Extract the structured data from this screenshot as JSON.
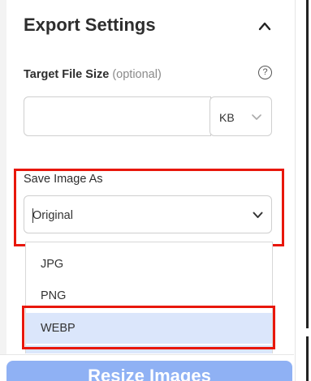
{
  "export_settings": {
    "title": "Export Settings",
    "target_file_size": {
      "label": "Target File Size",
      "optional_text": "(optional)",
      "help_glyph": "?",
      "value": "",
      "unit": "KB"
    },
    "save_image_as": {
      "label": "Save Image As",
      "selected": "Original",
      "options": [
        "JPG",
        "PNG",
        "WEBP"
      ],
      "highlighted_option": "WEBP"
    },
    "primary_button_label": "Resize Images"
  },
  "colors": {
    "annotation_red": "#e8170b",
    "option_highlight": "#dbe6fb",
    "button_blue": "#8fb1f4"
  },
  "icons": [
    "chevron-up-icon",
    "help-icon",
    "chevron-down-icon"
  ]
}
